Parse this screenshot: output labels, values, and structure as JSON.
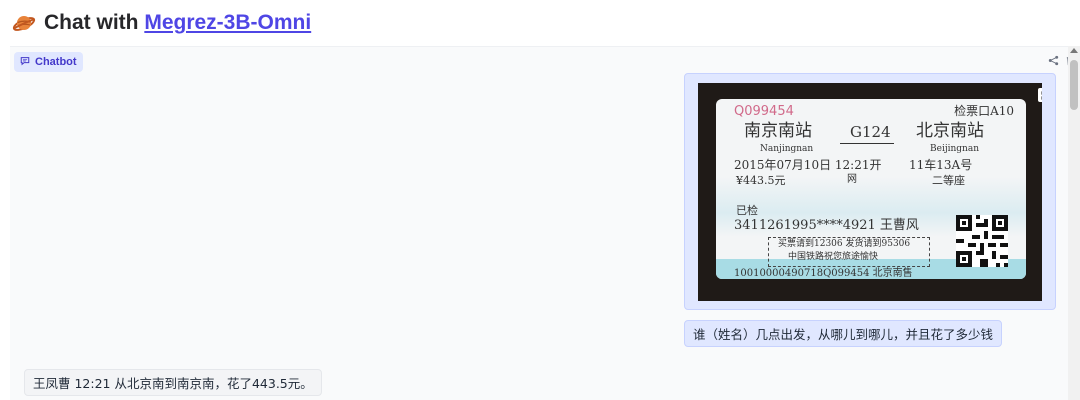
{
  "header": {
    "title_prefix": "Chat with ",
    "model_link": "Megrez-3B-Omni",
    "icon": "ringed-planet-icon"
  },
  "chatbot": {
    "badge_label": "Chatbot",
    "tools": [
      "share-icon",
      "trash-icon"
    ]
  },
  "messages": [
    {
      "role": "user",
      "type": "image",
      "ticket": {
        "serial": "Q099454",
        "gate": "检票口A10",
        "from": "南京南站",
        "from_pinyin": "Nanjingnan",
        "train": "G124",
        "to": "北京南站",
        "to_pinyin": "Beijingnan",
        "date_time": "2015年07月10日 12:21开",
        "seat": "11车13A号",
        "price": "¥443.5元",
        "net": "网",
        "class": "二等座",
        "checked": "已检",
        "id_name": "3411261995****4921 王曹风",
        "notice_1": "买票请到12306 发货请到95306",
        "notice_2": "中国铁路祝您旅途愉快",
        "bottom": "10010000490718Q099454 北京南售"
      }
    },
    {
      "role": "user",
      "type": "text",
      "text": "谁（姓名）几点出发，从哪儿到哪儿，并且花了多少钱"
    },
    {
      "role": "assistant",
      "type": "text",
      "text": "王凤曹 12:21 从北京南到南京南，花了443.5元。"
    }
  ],
  "colors": {
    "accent": "#4f46e5",
    "user_bubble": "#e0e7ff",
    "bot_bubble": "#f3f4f6"
  }
}
